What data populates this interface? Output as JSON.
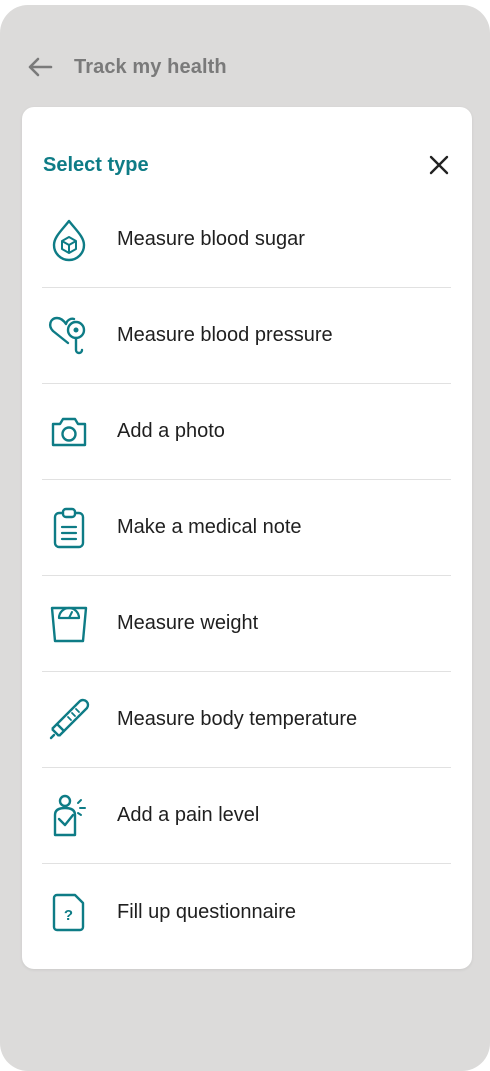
{
  "header": {
    "title": "Track my health",
    "back_icon": "arrow-left-icon"
  },
  "sheet": {
    "title": "Select type",
    "close_icon": "close-icon",
    "accent_color": "#0e7c86",
    "items": [
      {
        "label": "Measure blood sugar",
        "icon": "blood-drop-icon"
      },
      {
        "label": "Measure blood pressure",
        "icon": "heart-stethoscope-icon"
      },
      {
        "label": "Add a photo",
        "icon": "camera-icon"
      },
      {
        "label": "Make a medical note",
        "icon": "clipboard-note-icon"
      },
      {
        "label": "Measure weight",
        "icon": "weight-scale-icon"
      },
      {
        "label": "Measure body temperature",
        "icon": "thermometer-icon"
      },
      {
        "label": "Add a pain level",
        "icon": "pain-person-icon"
      },
      {
        "label": "Fill up questionnaire",
        "icon": "questionnaire-icon"
      }
    ]
  }
}
